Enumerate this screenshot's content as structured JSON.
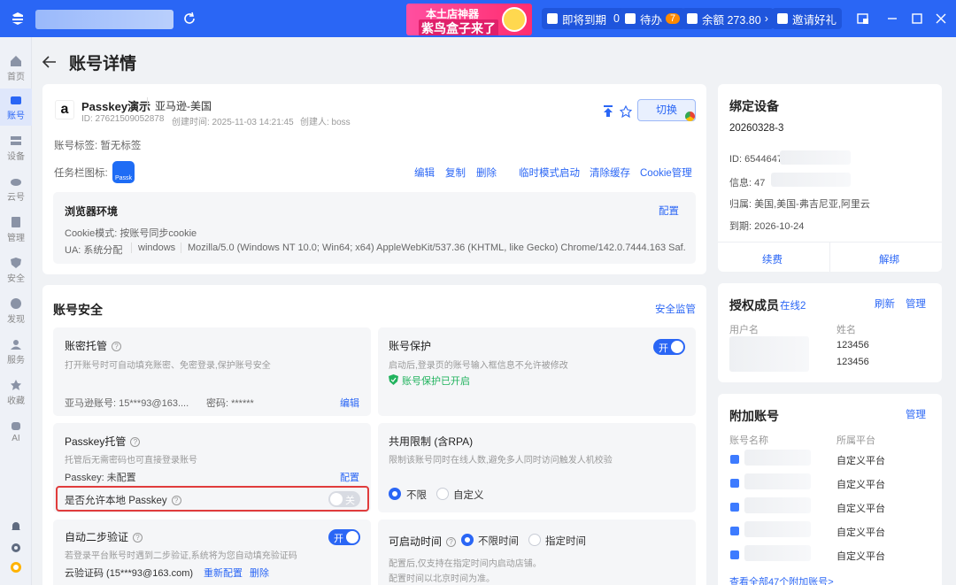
{
  "titlebar": {
    "promo_line1": "本土店神器",
    "promo_line2": "紫鸟盒子来了",
    "expiring_label": "即将到期",
    "expiring_count": "0",
    "todo_label": "待办",
    "todo_count": "7",
    "balance_label": "余额 273.80",
    "invite_label": "邀请好礼"
  },
  "sidebar": {
    "items": [
      {
        "label": "首页"
      },
      {
        "label": "账号"
      },
      {
        "label": "设备"
      },
      {
        "label": "云号"
      },
      {
        "label": "管理"
      },
      {
        "label": "安全"
      },
      {
        "label": "发现"
      },
      {
        "label": "服务"
      },
      {
        "label": "收藏"
      },
      {
        "label": "AI"
      }
    ]
  },
  "page": {
    "title": "账号详情"
  },
  "account": {
    "name": "Passkey演示",
    "platform": "亚马逊-美国",
    "id_text": "ID: 27621509052878",
    "created_text": "创建时间: 2025-11-03 14:21:45",
    "creator_text": "创建人: boss",
    "switch_label": "切换",
    "tags_text": "账号标签: 暂无标签",
    "taskbar_icon_label": "任务栏图标:",
    "taskbar_icon_text": "Passk",
    "actions": {
      "edit": "编辑",
      "copy": "复制",
      "delete": "删除",
      "temp_launch": "临时模式启动",
      "clear_cache": "清除缓存",
      "cookie_manage": "Cookie管理"
    },
    "browser_env": {
      "title": "浏览器环境",
      "config": "配置",
      "cookie_mode": "Cookie模式: 按账号同步cookie",
      "ua_label": "UA: 系统分配",
      "os": "windows",
      "ua_value": "Mozilla/5.0 (Windows NT 10.0; Win64; x64) AppleWebKit/537.36 (KHTML, like Gecko) Chrome/142.0.7444.163 Saf..."
    }
  },
  "security": {
    "title": "账号安全",
    "monitor": "安全监管",
    "password_box": {
      "title": "账密托管",
      "desc": "打开账号时可自动填充账密、免密登录,保护账号安全",
      "account_text": "亚马逊账号: 15***93@163....",
      "password_text": "密码: ******",
      "edit": "编辑"
    },
    "protect_box": {
      "title": "账号保护",
      "switch": "开",
      "desc": "启动后,登录页的账号输入框信息不允许被修改",
      "status": "账号保护已开启"
    },
    "passkey_box": {
      "title": "Passkey托管",
      "desc": "托管后无需密码也可直接登录账号",
      "status": "Passkey: 未配置",
      "config": "配置",
      "local_label": "是否允许本地 Passkey",
      "local_switch": "关"
    },
    "share_box": {
      "title": "共用限制 (含RPA)",
      "desc": "限制该账号同时在线人数,避免多人同时访问触发人机校验",
      "opt1": "不限",
      "opt2": "自定义"
    },
    "twofa_box": {
      "title": "自动二步验证",
      "switch": "开",
      "desc": "若登录平台账号时遇到二步验证,系统将为您自动填充验证码",
      "cloud_text": "云验证码 (15***93@163.com)",
      "reconfig": "重新配置",
      "delete": "删除"
    },
    "time_box": {
      "title": "可启动时间",
      "opt1": "不限时间",
      "opt2": "指定时间",
      "desc1": "配置后,仅支持在指定时间内启动店铺。",
      "desc2": "配置时间以北京时间为准。"
    }
  },
  "device": {
    "title": "绑定设备",
    "code": "20260328-3",
    "id_text": "ID: 6544647",
    "info_text": "信息: 47",
    "region_text": "归属: 美国,美国-弗吉尼亚,阿里云",
    "expire_text": "到期: 2026-10-24",
    "renew": "续费",
    "unbind": "解绑"
  },
  "members": {
    "title": "授权成员",
    "online": "在线2",
    "refresh": "刷新",
    "manage": "管理",
    "col_user": "用户名",
    "col_name": "姓名",
    "rows": [
      {
        "name": "123456"
      },
      {
        "name": "123456"
      }
    ]
  },
  "extra": {
    "title": "附加账号",
    "manage": "管理",
    "col_name": "账号名称",
    "col_platform": "所属平台",
    "rows": [
      {
        "platform": "自定义平台"
      },
      {
        "platform": "自定义平台"
      },
      {
        "platform": "自定义平台"
      },
      {
        "platform": "自定义平台"
      },
      {
        "platform": "自定义平台"
      }
    ],
    "view_all": "查看全部47个附加账号>"
  }
}
